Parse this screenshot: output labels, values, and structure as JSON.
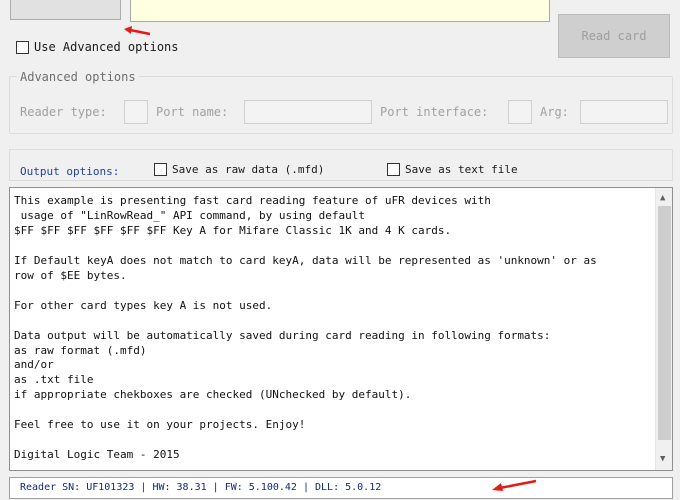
{
  "top": {
    "read_card_label": "Read card",
    "use_advanced_label": "Use Advanced options"
  },
  "advanced": {
    "legend": "Advanced options",
    "reader_type_label": "Reader type:",
    "port_name_label": "Port name:",
    "port_interface_label": "Port interface:",
    "arg_label": "Arg:"
  },
  "output": {
    "label": "Output options:",
    "raw_label": "Save as raw data (.mfd)",
    "text_label": "Save as text file"
  },
  "info_text": "This example is presenting fast card reading feature of uFR devices with\n usage of \"LinRowRead_\" API command, by using default\n$FF $FF $FF $FF $FF $FF Key A for Mifare Classic 1K and 4 K cards.\n\nIf Default keyA does not match to card keyA, data will be represented as 'unknown' or as\nrow of $EE bytes.\n\nFor other card types key A is not used.\n\nData output will be automatically saved during card reading in following formats:\nas raw format (.mfd)\nand/or\nas .txt file\nif appropriate chekboxes are checked (UNchecked by default).\n\nFeel free to use it on your projects. Enjoy!\n\nDigital Logic Team - 2015",
  "status": {
    "text": "Reader SN: UF101323 | HW: 38.31 | FW: 5.100.42 | DLL: 5.0.12"
  },
  "colors": {
    "annotation_arrow": "#e41b17",
    "text_field_yellow": "#ffffe1"
  }
}
